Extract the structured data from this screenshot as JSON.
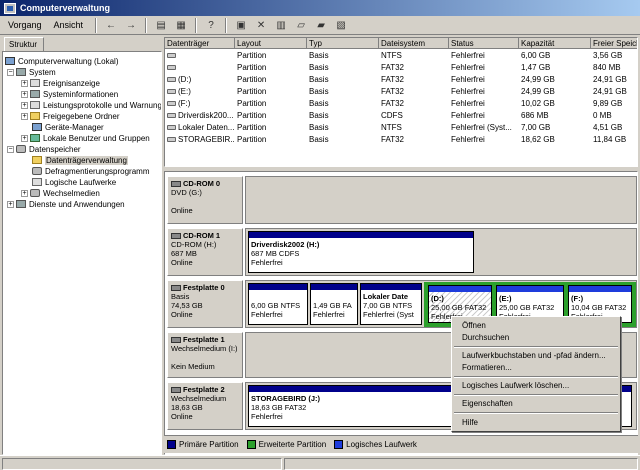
{
  "window": {
    "title": "Computerverwaltung"
  },
  "menu": {
    "items": [
      "Vorgang",
      "Ansicht"
    ]
  },
  "toolbar": {
    "icons": [
      "back-arrow-icon",
      "forward-arrow-icon",
      "up-folder-icon",
      "show-hide-tree-icon",
      "help-icon",
      "export-list-icon",
      "delete-icon",
      "properties-icon",
      "open-folder-icon",
      "explore-icon",
      "help-topic-icon"
    ]
  },
  "tree": {
    "tab_label": "Struktur",
    "nodes": [
      {
        "label": "Computerverwaltung (Lokal)",
        "icon": "computer-icon",
        "pm": "-"
      },
      {
        "label": "System",
        "icon": "tools-icon",
        "pm": "-"
      },
      {
        "label": "Ereignisanzeige",
        "icon": "event-icon",
        "pm": "+"
      },
      {
        "label": "Systeminformationen",
        "icon": "info-icon",
        "pm": "+"
      },
      {
        "label": "Leistungsprotokolle und Warnungen",
        "icon": "perf-icon",
        "pm": "+"
      },
      {
        "label": "Freigegebene Ordner",
        "icon": "folder-icon",
        "pm": "+"
      },
      {
        "label": "Geräte-Manager",
        "icon": "device-icon",
        "pm": ""
      },
      {
        "label": "Lokale Benutzer und Gruppen",
        "icon": "users-icon",
        "pm": "+"
      },
      {
        "label": "Datenspeicher",
        "icon": "storage-icon",
        "pm": "-"
      },
      {
        "label": "Datenträgerverwaltung",
        "icon": "disk-mgmt-icon",
        "pm": ""
      },
      {
        "label": "Defragmentierungsprogramm",
        "icon": "defrag-icon",
        "pm": ""
      },
      {
        "label": "Logische Laufwerke",
        "icon": "logical-drive-icon",
        "pm": ""
      },
      {
        "label": "Wechselmedien",
        "icon": "removable-icon",
        "pm": "+"
      },
      {
        "label": "Dienste und Anwendungen",
        "icon": "services-icon",
        "pm": "+"
      }
    ]
  },
  "list": {
    "columns": [
      "Datenträger",
      "Layout",
      "Typ",
      "Dateisystem",
      "Status",
      "Kapazität",
      "Freier Speich"
    ],
    "rows": [
      [
        "",
        "Partition",
        "Basis",
        "NTFS",
        "Fehlerfrei",
        "6,00 GB",
        "3,56 GB"
      ],
      [
        "",
        "Partition",
        "Basis",
        "FAT32",
        "Fehlerfrei",
        "1,47 GB",
        "840 MB"
      ],
      [
        "(D:)",
        "Partition",
        "Basis",
        "FAT32",
        "Fehlerfrei",
        "24,99 GB",
        "24,91 GB"
      ],
      [
        "(E:)",
        "Partition",
        "Basis",
        "FAT32",
        "Fehlerfrei",
        "24,99 GB",
        "24,91 GB"
      ],
      [
        "(F:)",
        "Partition",
        "Basis",
        "FAT32",
        "Fehlerfrei",
        "10,02 GB",
        "9,89 GB"
      ],
      [
        "Driverdisk200...",
        "Partition",
        "Basis",
        "CDFS",
        "Fehlerfrei",
        "686 MB",
        "0 MB"
      ],
      [
        "Lokaler Daten...",
        "Partition",
        "Basis",
        "NTFS",
        "Fehlerfrei (Syst...",
        "7,00 GB",
        "4,51 GB"
      ],
      [
        "STORAGEBIR...",
        "Partition",
        "Basis",
        "FAT32",
        "Fehlerfrei",
        "18,62 GB",
        "11,84 GB"
      ]
    ]
  },
  "disks": [
    {
      "name": "CD-ROM 0",
      "lines": [
        "DVD (G:)",
        "",
        "Online"
      ],
      "partitions": []
    },
    {
      "name": "CD-ROM 1",
      "lines": [
        "CD-ROM (H:)",
        "687 MB",
        "Online"
      ],
      "partitions": [
        {
          "name": "Driverdisk2002  (H:)",
          "size": "687 MB CDFS",
          "status": "Fehlerfrei"
        }
      ]
    },
    {
      "name": "Festplatte 0",
      "lines": [
        "Basis",
        "74,53 GB",
        "Online"
      ],
      "partitions": [
        {
          "name": "",
          "size": "6,00 GB NTFS",
          "status": "Fehlerfrei"
        },
        {
          "name": "",
          "size": "1,49 GB FA",
          "status": "Fehlerfrei"
        },
        {
          "name": "Lokaler Date",
          "size": "7,00 GB NTFS",
          "status": "Fehlerfrei (Syst"
        },
        {
          "name": "(D:)",
          "size": "25,00 GB FAT32",
          "status": "Fehlerfrei"
        },
        {
          "name": "(E:)",
          "size": "25,00 GB FAT32",
          "status": "Fehlerfrei"
        },
        {
          "name": "(F:)",
          "size": "10,04 GB FAT32",
          "status": "Fehlerfrei"
        }
      ]
    },
    {
      "name": "Festplatte 1",
      "lines": [
        "Wechselmedium (I:)",
        "",
        "Kein Medium"
      ],
      "partitions": []
    },
    {
      "name": "Festplatte 2",
      "lines": [
        "Wechselmedium",
        "18,63 GB",
        "Online"
      ],
      "partitions": [
        {
          "name": "STORAGEBIRD  (J:)",
          "size": "18,63 GB FAT32",
          "status": "Fehlerfrei"
        }
      ]
    }
  ],
  "legend": [
    {
      "label": "Primäre Partition",
      "color": "#00008b"
    },
    {
      "label": "Erweiterte Partition",
      "color": "#2ca02c"
    },
    {
      "label": "Logisches Laufwerk",
      "color": "#1e3cdc"
    }
  ],
  "context_menu": {
    "items": [
      "Öffnen",
      "Durchsuchen",
      "Laufwerkbuchstaben und -pfad ändern...",
      "Formatieren...",
      "Logisches Laufwerk löschen...",
      "Eigenschaften",
      "Hilfe"
    ]
  }
}
